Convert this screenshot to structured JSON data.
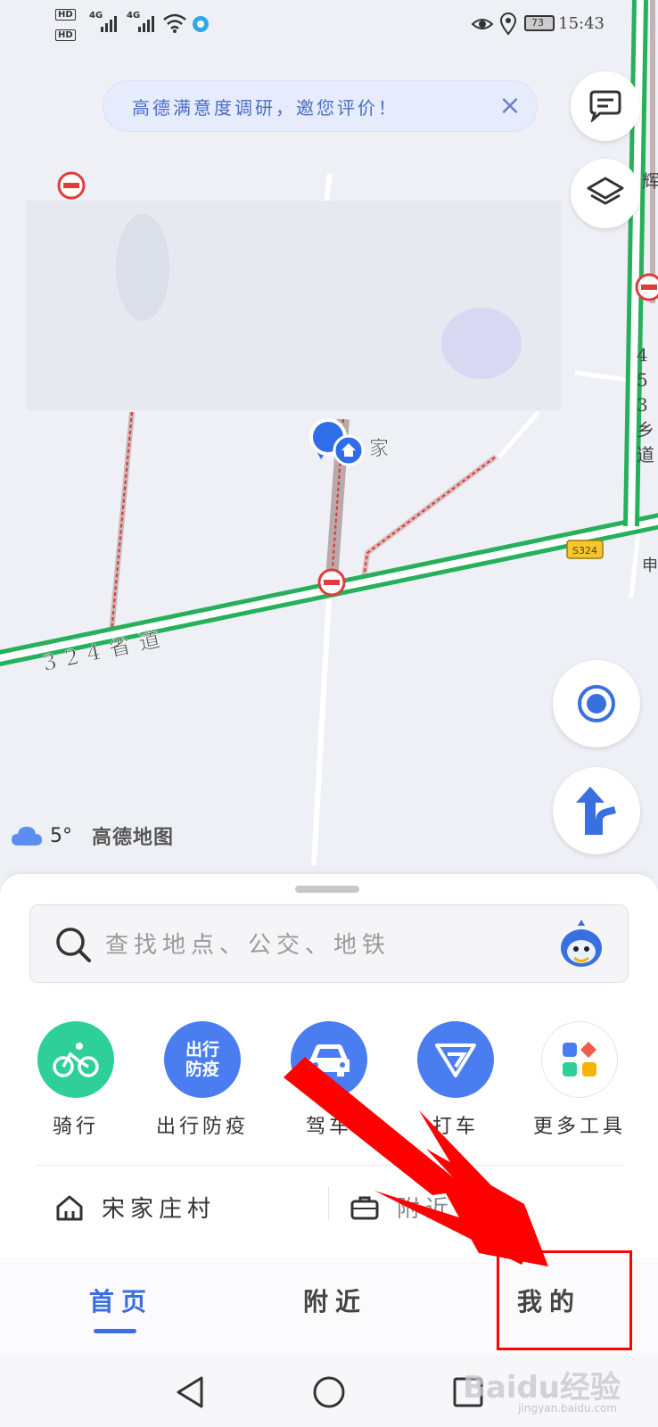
{
  "status_bar": {
    "sim1": "HD",
    "sim2": "HD",
    "net1": "4G",
    "net2": "4G",
    "battery": "73",
    "time": "15:43"
  },
  "map": {
    "banner_text": "高德满意度调研，邀您评价！",
    "home_label": "家",
    "road_label": "324省道",
    "road_label_right": "453乡道",
    "shield": "S324",
    "edge_label_top": "辉",
    "edge_label_bottom": "申"
  },
  "weather": {
    "temp": "5°",
    "brand": "高德地图"
  },
  "search": {
    "placeholder": "查找地点、公交、地铁"
  },
  "tools": [
    {
      "label": "骑行",
      "color": "#2fcf9a"
    },
    {
      "label": "出行防疫",
      "color": "#4a7ef0",
      "icon_text": "出行防疫"
    },
    {
      "label": "驾车",
      "color": "#4a7ef0"
    },
    {
      "label": "打车",
      "color": "#4a7ef0"
    },
    {
      "label": "更多工具",
      "color": "#ffffff"
    }
  ],
  "quick": {
    "home": "宋家庄村",
    "work": "附近"
  },
  "tabs": {
    "home": "首页",
    "nearby": "附近",
    "mine": "我的"
  },
  "colors": {
    "accent": "#3a6fe0",
    "road_green": "#27b05b",
    "annotation": "#ff0000"
  },
  "watermark": {
    "brand": "Baidu经验",
    "url": "jingyan.baidu.com"
  }
}
